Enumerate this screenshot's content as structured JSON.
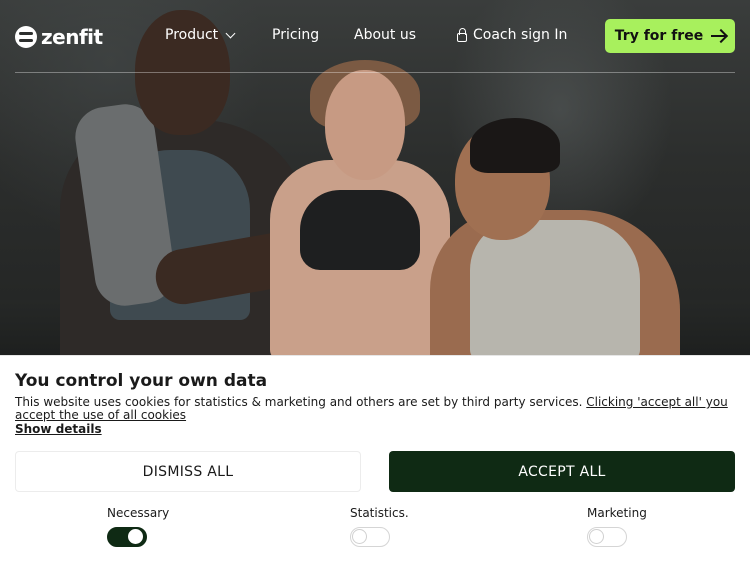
{
  "brand": {
    "name": "zenfit",
    "accent_color": "#a8f05d",
    "dark_color": "#0f2a14"
  },
  "nav": {
    "links": [
      {
        "label": "Product",
        "icon": "chevron-down-icon"
      },
      {
        "label": "Pricing"
      },
      {
        "label": "About us"
      },
      {
        "label": "Coach sign In",
        "icon": "lock-icon"
      }
    ],
    "cta_label": "Try for free",
    "cta_icon": "arrow-right-icon"
  },
  "cookie_banner": {
    "title": "You control your own data",
    "description": "This website uses cookies for statistics & marketing and others are set by third party services.",
    "accept_link_text": "Clicking 'accept all' you accept the use of all cookies",
    "details_link": "Show details",
    "dismiss_label": "DISMISS ALL",
    "accept_label": "ACCEPT ALL",
    "toggles": [
      {
        "label": "Necessary",
        "checked": true
      },
      {
        "label": "Statistics.",
        "checked": false
      },
      {
        "label": "Marketing",
        "checked": false
      }
    ]
  }
}
